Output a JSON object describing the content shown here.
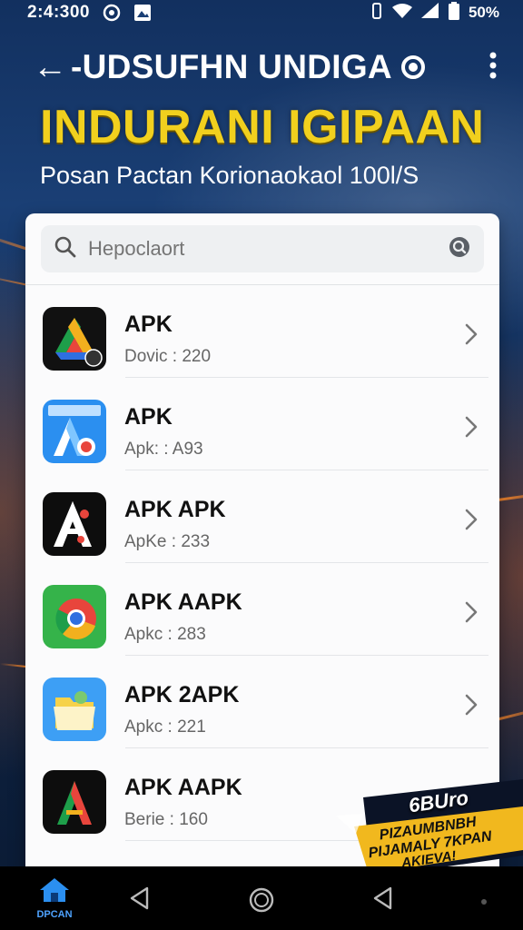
{
  "status_bar": {
    "time": "2:4:300",
    "battery": "50%"
  },
  "header": {
    "back_label": "←",
    "title": "-UDSUFHN UNDIGA",
    "banner_title": "INDURANI IGIPAAN",
    "banner_subtitle": "Posan Pactan Korionaokaol 100l/S"
  },
  "search": {
    "placeholder": "Hepoclaort"
  },
  "apps": [
    {
      "name": "APK",
      "detail": "Dovic : 220",
      "icon": "drive-style-icon"
    },
    {
      "name": "APK",
      "detail": "Apk: : A93",
      "icon": "blue-a-icon"
    },
    {
      "name": "APK APK",
      "detail": "ApKe : 233",
      "icon": "black-a-icon"
    },
    {
      "name": "APK AAPK",
      "detail": "Apkc : 283",
      "icon": "chrome-style-icon"
    },
    {
      "name": "APK 2APK",
      "detail": "Apkc : 221",
      "icon": "folder-icon"
    },
    {
      "name": "APK AAPK",
      "detail": "Berie : 160",
      "icon": "dark-a-icon"
    }
  ],
  "promo": {
    "line1": "6BUro",
    "line2": "PIZAUMBNBH\nPIJAMALY 7KPAN",
    "line3": "AKIEVA!"
  },
  "nav": {
    "home_label": "DPCAN"
  }
}
